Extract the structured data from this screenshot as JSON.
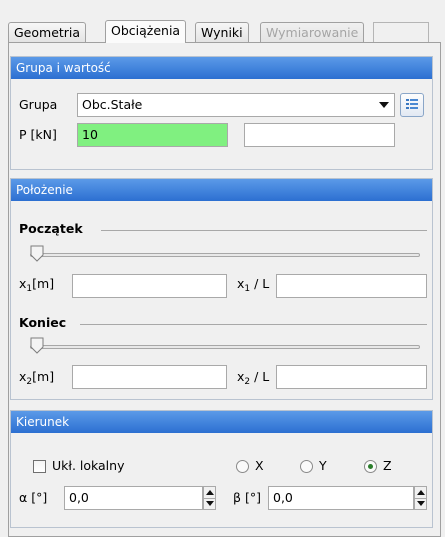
{
  "tabs": [
    {
      "label": "Geometria",
      "state": "normal"
    },
    {
      "label": "Obciążenia",
      "state": "active"
    },
    {
      "label": "Wyniki",
      "state": "normal"
    },
    {
      "label": "Wymiarowanie",
      "state": "disabled"
    }
  ],
  "group_panel": {
    "title": "Grupa i wartość",
    "group_label": "Grupa",
    "group_value": "Obc.Stałe",
    "group_button_icon": "list-icon",
    "p_label": "P [kN]",
    "p_value": "10",
    "extra_value": ""
  },
  "position_panel": {
    "title": "Położenie",
    "start": {
      "heading": "Początek",
      "slider_value": 0,
      "x_label_base": "x",
      "x_label_sub": "1",
      "x_label_unit": "[m]",
      "x_value": "",
      "ratio_label_base": "x",
      "ratio_label_sub": "1",
      "ratio_label_rest": " / L",
      "ratio_value": ""
    },
    "end": {
      "heading": "Koniec",
      "slider_value": 0,
      "x_label_base": "x",
      "x_label_sub": "2",
      "x_label_unit": "[m]",
      "x_value": "",
      "ratio_label_base": "x",
      "ratio_label_sub": "2",
      "ratio_label_rest": " / L",
      "ratio_value": ""
    }
  },
  "direction_panel": {
    "title": "Kierunek",
    "local_label": "Ukł. lokalny",
    "local_checked": false,
    "radios": [
      {
        "label": "X",
        "checked": false
      },
      {
        "label": "Y",
        "checked": false
      },
      {
        "label": "Z",
        "checked": true
      }
    ],
    "alpha_label": "α [°]",
    "alpha_value": "0,0",
    "beta_label": "β [°]",
    "beta_value": "0,0"
  },
  "colors": {
    "panel_header": "#2c6fd1",
    "highlight_input": "#80f080"
  }
}
